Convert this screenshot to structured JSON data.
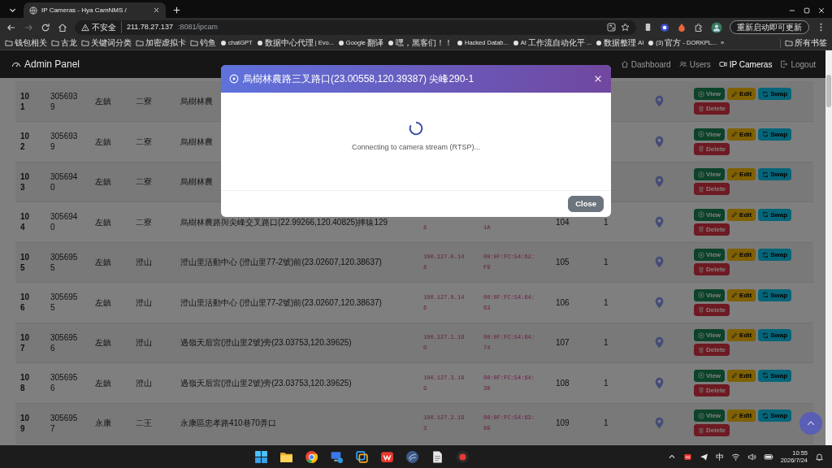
{
  "browser": {
    "tab": {
      "title": "IP Cameras - Hya CamNMS /"
    },
    "address_bar": {
      "security": "不安全",
      "host": "211.78.27.137",
      "path": ":8081/ipcam"
    },
    "update_button": "重新启动即可更新",
    "bookmarks": [
      {
        "label": "钱包相关",
        "kind": "folder"
      },
      {
        "label": "古龙",
        "kind": "folder"
      },
      {
        "label": "关键词分类",
        "kind": "folder"
      },
      {
        "label": "加密虚拟卡",
        "kind": "folder"
      },
      {
        "label": "钓鱼",
        "kind": "folder"
      },
      {
        "label": "chatGPT",
        "kind": "site"
      },
      {
        "label": "数据中心代理 | Evo...",
        "kind": "site"
      },
      {
        "label": "Google 翻译",
        "kind": "site"
      },
      {
        "label": "嘿，黑客们！！",
        "kind": "site"
      },
      {
        "label": "Hacked Datab...",
        "kind": "site"
      },
      {
        "label": "AI 工作流自动化平...",
        "kind": "site"
      },
      {
        "label": "数据整理AI",
        "kind": "site"
      },
      {
        "label": "(3) 官方 - DORKPL...",
        "kind": "site"
      }
    ],
    "overflow": "»",
    "all_bookmarks": "所有书签"
  },
  "navbar": {
    "brand": "Admin Panel",
    "links": [
      {
        "label": "Dashboard",
        "kind": "home",
        "selected": false
      },
      {
        "label": "Users",
        "kind": "users",
        "selected": false
      },
      {
        "label": "IP Cameras",
        "kind": "camera",
        "selected": true
      },
      {
        "label": "Logout",
        "kind": "logout",
        "selected": false
      }
    ]
  },
  "table": {
    "rows": [
      {
        "column_1": "101",
        "column_2": "3056939",
        "column_3": "左鎮",
        "column_4": "二寮",
        "column_5": "烏樹林農",
        "actions": [
          {
            "label": "View",
            "kind": "view"
          },
          {
            "label": "Edit",
            "kind": "edit"
          },
          {
            "label": "Swap",
            "kind": "swap"
          },
          {
            "label": "Delete",
            "kind": "delete"
          }
        ]
      },
      {
        "column_1": "102",
        "column_2": "3056939",
        "column_3": "左鎮",
        "column_4": "二寮",
        "column_5": "烏樹林農",
        "actions": [
          {
            "label": "View",
            "kind": "view"
          },
          {
            "label": "Edit",
            "kind": "edit"
          },
          {
            "label": "Swap",
            "kind": "swap"
          },
          {
            "label": "Delete",
            "kind": "delete"
          }
        ]
      },
      {
        "column_1": "103",
        "column_2": "3056940",
        "column_3": "左鎮",
        "column_4": "二寮",
        "column_5": "烏樹林農",
        "actions": [
          {
            "label": "View",
            "kind": "view"
          },
          {
            "label": "Edit",
            "kind": "edit"
          },
          {
            "label": "Swap",
            "kind": "swap"
          },
          {
            "label": "Delete",
            "kind": "delete"
          }
        ]
      },
      {
        "column_1": "104",
        "column_2": "3056940",
        "column_3": "左鎮",
        "column_4": "二寮",
        "column_5": "烏樹林農路與尖峰交叉路口(22.99266,120.40825)摔猿129",
        "column_6": "8",
        "column_7": "1A",
        "column_8": "104",
        "column_9": "1",
        "actions": [
          {
            "label": "View",
            "kind": "view"
          },
          {
            "label": "Edit",
            "kind": "edit"
          },
          {
            "label": "Swap",
            "kind": "swap"
          },
          {
            "label": "Delete",
            "kind": "delete"
          }
        ]
      },
      {
        "column_1": "105",
        "column_2": "3056955",
        "column_3": "左鎮",
        "column_4": "澄山",
        "column_5": "澄山里活動中心 (澄山里77-2號)前(23.02607,120.38637)",
        "column_6": "100.127.0.148",
        "column_7": "00:0F:FC:54:62:F9",
        "column_8": "105",
        "column_9": "1",
        "actions": [
          {
            "label": "View",
            "kind": "view"
          },
          {
            "label": "Edit",
            "kind": "edit"
          },
          {
            "label": "Swap",
            "kind": "swap"
          },
          {
            "label": "Delete",
            "kind": "delete"
          }
        ]
      },
      {
        "column_1": "106",
        "column_2": "3056955",
        "column_3": "左鎮",
        "column_4": "澄山",
        "column_5": "澄山里活動中心 (澄山里77-2號)前(23.02607,120.38637)",
        "column_6": "100.127.0.146",
        "column_7": "00:0F:FC:54:64:63",
        "column_8": "106",
        "column_9": "1",
        "actions": [
          {
            "label": "View",
            "kind": "view"
          },
          {
            "label": "Edit",
            "kind": "edit"
          },
          {
            "label": "Swap",
            "kind": "swap"
          },
          {
            "label": "Delete",
            "kind": "delete"
          }
        ]
      },
      {
        "column_1": "107",
        "column_2": "3056956",
        "column_3": "左鎮",
        "column_4": "澄山",
        "column_5": "過嶺天后宮(澄山里2號)旁(23.03753,120.39625)",
        "column_6": "100.127.1.190",
        "column_7": "00:0F:FC:54:64:74",
        "column_8": "107",
        "column_9": "1",
        "actions": [
          {
            "label": "View",
            "kind": "view"
          },
          {
            "label": "Edit",
            "kind": "edit"
          },
          {
            "label": "Swap",
            "kind": "swap"
          },
          {
            "label": "Delete",
            "kind": "delete"
          }
        ]
      },
      {
        "column_1": "108",
        "column_2": "3056956",
        "column_3": "左鎮",
        "column_4": "澄山",
        "column_5": "過嶺天后宮(澄山里2號)旁(23.03753,120.39625)",
        "column_6": "100.127.3.199",
        "column_7": "00:0F:FC:54:64:38",
        "column_8": "108",
        "column_9": "1",
        "actions": [
          {
            "label": "View",
            "kind": "view"
          },
          {
            "label": "Edit",
            "kind": "edit"
          },
          {
            "label": "Swap",
            "kind": "swap"
          },
          {
            "label": "Delete",
            "kind": "delete"
          }
        ]
      },
      {
        "column_1": "109",
        "column_2": "3056957",
        "column_3": "永康",
        "column_4": "二王",
        "column_5": "永康區忠孝路410巷70弄口",
        "column_6": "100.127.2.193",
        "column_7": "00:0F:FC:54:63:89",
        "column_8": "109",
        "column_9": "1",
        "actions": [
          {
            "label": "View",
            "kind": "view"
          },
          {
            "label": "Edit",
            "kind": "edit"
          },
          {
            "label": "Swap",
            "kind": "swap"
          },
          {
            "label": "Delete",
            "kind": "delete"
          }
        ]
      }
    ]
  },
  "modal": {
    "title": "烏樹林農路三叉路口(23.00558,120.39387) 尖峰290-1",
    "message": "Connecting to camera stream (RTSP)...",
    "close_button": "Close"
  },
  "taskbar": {
    "ime": "中",
    "time": "10:55",
    "date": "2026/7/24"
  }
}
